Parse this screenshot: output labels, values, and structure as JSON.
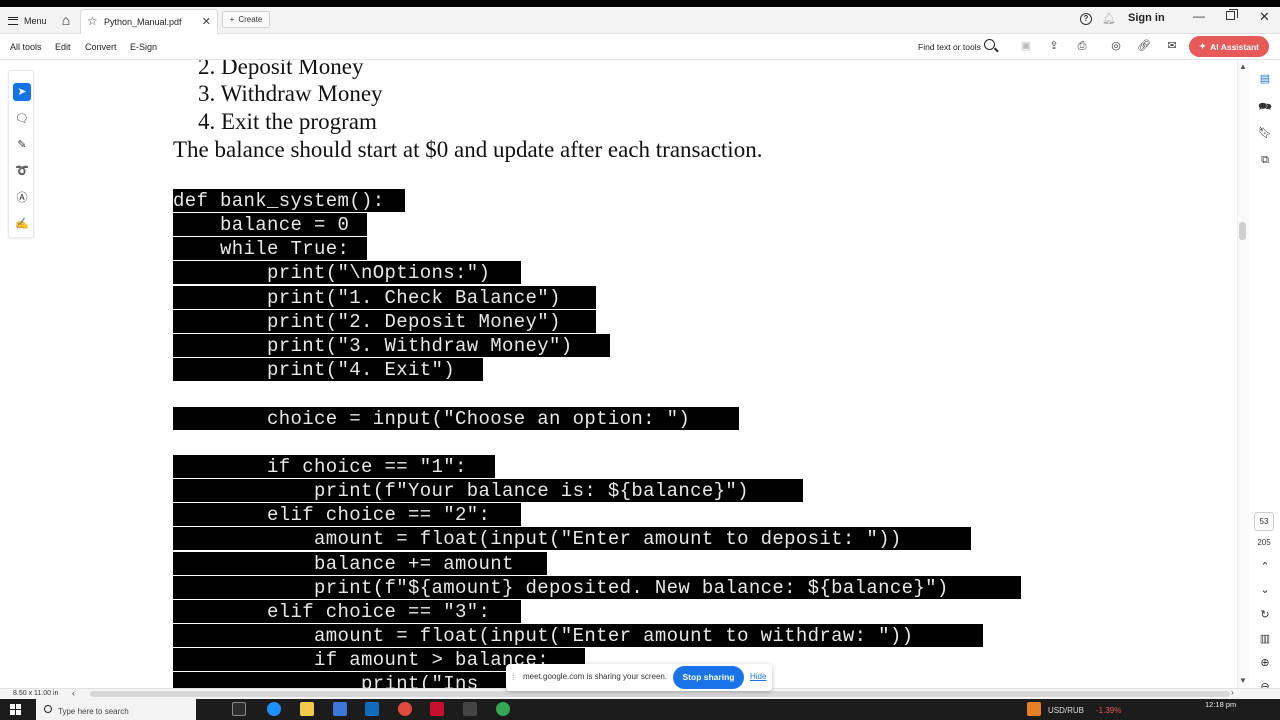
{
  "window": {
    "menu_label": "Menu",
    "tab_title": "Python_Manual.pdf",
    "create_label": "Create",
    "signin_label": "Sign in"
  },
  "toolbar": {
    "items": [
      "All tools",
      "Edit",
      "Convert",
      "E-Sign"
    ],
    "find_label": "Find text or tools",
    "ai_label": "AI Assistant"
  },
  "document": {
    "list_items": [
      "2. Deposit Money",
      "3. Withdraw Money",
      "4. Exit the program"
    ],
    "paragraph": "The balance should start at $0 and update after each transaction.",
    "code_lines": [
      "def bank_system():",
      "    balance = 0",
      "    while True:",
      "        print(\"\\nOptions:\")",
      "        print(\"1. Check Balance\")",
      "        print(\"2. Deposit Money\")",
      "        print(\"3. Withdraw Money\")",
      "        print(\"4. Exit\")",
      "",
      "        choice = input(\"Choose an option: \")",
      "",
      "        if choice == \"1\":",
      "            print(f\"Your balance is: ${balance}\")",
      "        elif choice == \"2\":",
      "            amount = float(input(\"Enter amount to deposit: \"))",
      "            balance += amount",
      "            print(f\"${amount} deposited. New balance: ${balance}\")",
      "        elif choice == \"3\":",
      "            amount = float(input(\"Enter amount to withdraw: \"))",
      "            if amount > balance:",
      "                print(\"Ins"
    ]
  },
  "navigation": {
    "current_page": "53",
    "total_pages": "205"
  },
  "status": {
    "page_size": "8.50 x 11.00 in"
  },
  "share_bar": {
    "message": "meet.google.com is sharing your screen.",
    "stop_label": "Stop sharing",
    "hide_label": "Hide"
  },
  "taskbar": {
    "search_placeholder": "Type here to search",
    "ticker": "USD/RUB",
    "ticker_change": "-1.39%",
    "time": "12:18 pm"
  },
  "colors": {
    "accent": "#1473e6",
    "ai_button": "#e85a59",
    "share_button": "#1a73e8"
  }
}
